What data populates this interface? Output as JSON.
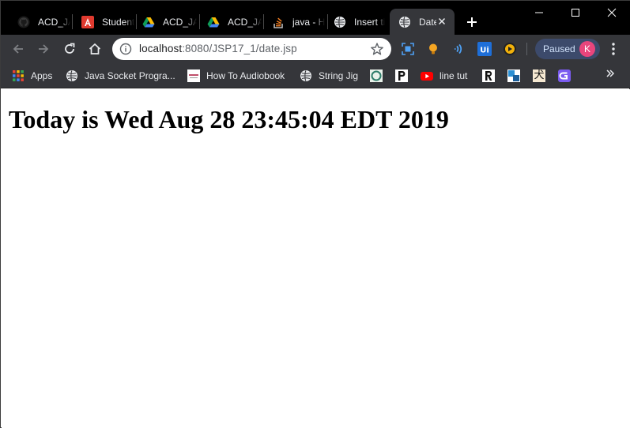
{
  "browser": {
    "tabs": [
      {
        "label": "ACD_JA",
        "icon": "github-icon",
        "active": false
      },
      {
        "label": "Student",
        "icon": "red-a-icon",
        "active": false
      },
      {
        "label": "ACD_JA",
        "icon": "google-drive-icon",
        "active": false
      },
      {
        "label": "ACD_JA",
        "icon": "google-drive-icon",
        "active": false
      },
      {
        "label": "java - H",
        "icon": "stackoverflow-icon",
        "active": false
      },
      {
        "label": "Insert ti",
        "icon": "globe-icon",
        "active": false
      },
      {
        "label": "Date",
        "icon": "globe-icon",
        "active": true
      }
    ],
    "address_bar": {
      "host": "localhost",
      "path": ":8080/JSP17_1/date.jsp"
    },
    "profile": {
      "status_label": "Paused",
      "avatar_letter": "K",
      "avatar_color": "#e8457c"
    },
    "bookmarks": [
      {
        "label": "Apps",
        "icon": "apps-grid-icon"
      },
      {
        "label": "Java Socket Progra...",
        "icon": "globe-icon"
      },
      {
        "label": "How To Audiobook",
        "icon": "audiobook-thumbnail-icon"
      },
      {
        "label": "String Jig",
        "icon": "globe-icon"
      },
      {
        "label": "",
        "icon": "circle-logo-icon"
      },
      {
        "label": "",
        "icon": "p-logo-icon"
      },
      {
        "label": "line tut",
        "icon": "youtube-icon"
      },
      {
        "label": "",
        "icon": "r-logo-icon"
      },
      {
        "label": "",
        "icon": "blue-square-icon"
      },
      {
        "label": "",
        "icon": "kanji-icon"
      },
      {
        "label": "",
        "icon": "purple-logo-icon"
      }
    ],
    "kanji_glyph": "犬",
    "colors": {
      "tabstrip": "#000000",
      "toolbar": "#35363a",
      "accent": "#8ab4f8"
    }
  },
  "page": {
    "heading": "Today is Wed Aug 28 23:45:04 EDT 2019"
  }
}
